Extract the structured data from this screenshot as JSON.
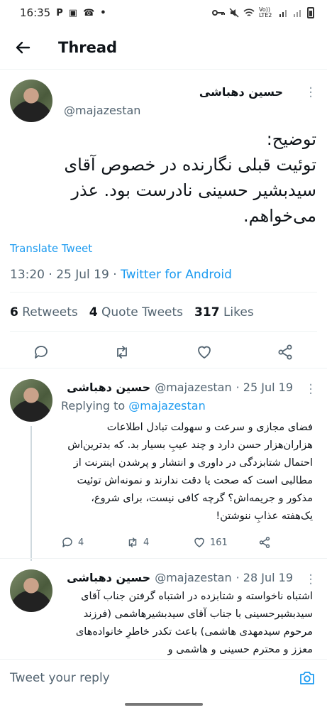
{
  "status_bar": {
    "time": "16:35",
    "left_icons": [
      "P",
      "▣",
      "☎",
      "•"
    ],
    "right_text": "Vo)) LTE2"
  },
  "header": {
    "title": "Thread"
  },
  "main_tweet": {
    "name": "حسین دهباشی",
    "handle": "@majazestan",
    "text": "توضیح:\nتوئیت قبلی نگارنده در خصوص آقای سیدبشیر حسینی نادرست بود. عذر می‌خواهم.",
    "translate_label": "Translate Tweet",
    "time": "13:20",
    "date": "25 Jul 19",
    "source": "Twitter for Android",
    "retweets": {
      "count": "6",
      "label": "Retweets"
    },
    "quotes": {
      "count": "4",
      "label": "Quote Tweets"
    },
    "likes": {
      "count": "317",
      "label": "Likes"
    }
  },
  "replies": [
    {
      "name": "حسین دهباشی",
      "handle": "@majazestan",
      "date": "· 25 Jul 19",
      "replying_prefix": "Replying to",
      "replying_to": "@majazestan",
      "text": "فضای مجازی و سرعت و سهولت تبادل اطلاعات هزاران‌هزار حسن دارد و چند عیبِ بسیار بد. که بدترین‌اش احتمال شتابزدگی در داوری و انتشار و پرشدن اینترنت از مطالبی است که صحت یا دقت ندارند و نمونه‌اش توئیت مذکور و جریمه‌اش؟ گرچه کافی نیست، برای شروع، یک‌هفته عذابِ ننوشتن!",
      "reply_count": "4",
      "retweet_count": "4",
      "like_count": "161"
    },
    {
      "name": "حسین دهباشی",
      "handle": "@majazestan",
      "date": "· 28 Jul 19",
      "text": "اشتباه ناخواسته و شتابزده در اشتباه گرفتن جناب آقای سیدبشیرحسینی با جناب آقای سیدبشیرهاشمی (فرزند مرحوم سیدمهدی هاشمی) باعث تکدر خاطرِ خانواده‌های معزز و محترم حسینی و هاشمی و"
    }
  ],
  "composer": {
    "placeholder": "Tweet your reply"
  },
  "colors": {
    "accent": "#1d9bf0",
    "secondary": "#536471",
    "text": "#0f1419"
  }
}
